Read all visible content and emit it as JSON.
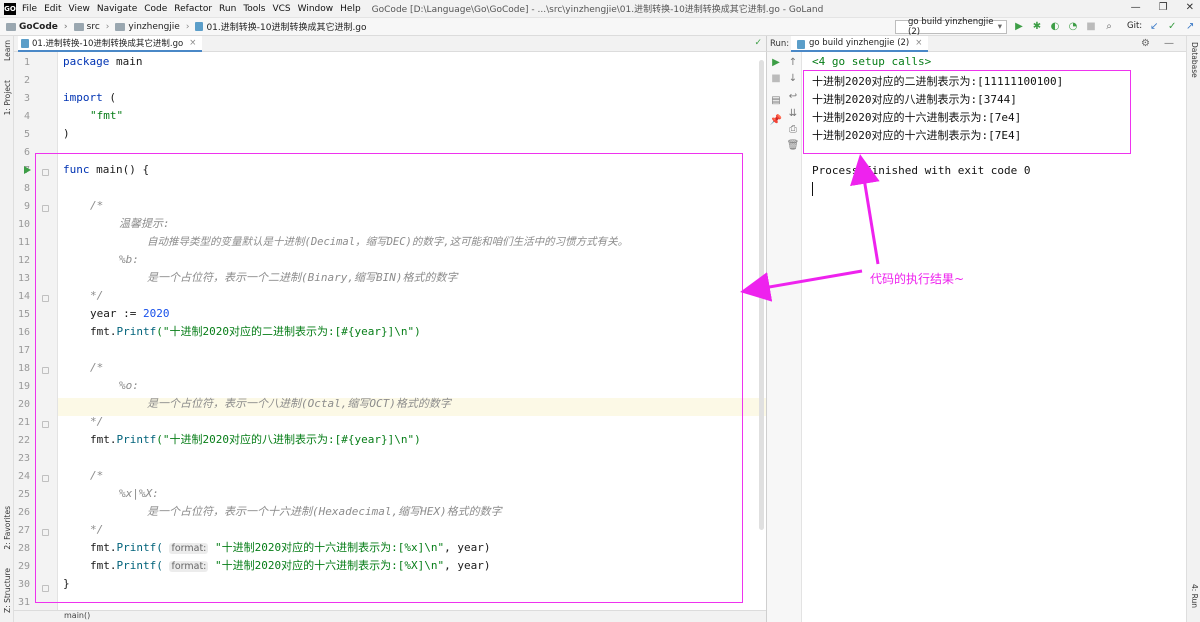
{
  "window": {
    "app_icon": "GO",
    "menu": [
      "File",
      "Edit",
      "View",
      "Navigate",
      "Code",
      "Refactor",
      "Run",
      "Tools",
      "VCS",
      "Window",
      "Help"
    ],
    "title": "GoCode [D:\\Language\\Go\\GoCode] - ...\\src\\yinzhengjie\\01.进制转换-10进制转换成其它进制.go - GoLand"
  },
  "navbar": {
    "breadcrumbs": [
      "GoCode",
      "src",
      "yinzhengjie",
      "01.进制转换-10进制转换成其它进制.go"
    ],
    "run_config": "go build yinzhengjie (2)",
    "git_label": "Git:"
  },
  "side_tools": {
    "left": [
      "1: Project",
      "Learn",
      "2: Favorites",
      "Z: Structure"
    ],
    "right": [
      "Database",
      "4: Run"
    ]
  },
  "editor": {
    "tab_label": "01.进制转换-10进制转换成其它进制.go",
    "status_text": "main()",
    "lines": [
      {
        "n": "1"
      },
      {
        "n": "2"
      },
      {
        "n": "3"
      },
      {
        "n": "4"
      },
      {
        "n": "5"
      },
      {
        "n": "6"
      },
      {
        "n": "7"
      },
      {
        "n": "8"
      },
      {
        "n": "9"
      },
      {
        "n": "10"
      },
      {
        "n": "11"
      },
      {
        "n": "12"
      },
      {
        "n": "13"
      },
      {
        "n": "14"
      },
      {
        "n": "15"
      },
      {
        "n": "16"
      },
      {
        "n": "17"
      },
      {
        "n": "18"
      },
      {
        "n": "19"
      },
      {
        "n": "20"
      },
      {
        "n": "21"
      },
      {
        "n": "22"
      },
      {
        "n": "23"
      },
      {
        "n": "24"
      },
      {
        "n": "25"
      },
      {
        "n": "26"
      },
      {
        "n": "27"
      },
      {
        "n": "28"
      },
      {
        "n": "29"
      },
      {
        "n": "30"
      },
      {
        "n": "31"
      }
    ],
    "code": {
      "l1_kw": "package",
      "l1_name": "main",
      "l3_kw": "import",
      "l3_paren": "(",
      "l4_str": "\"fmt\"",
      "l5_paren": ")",
      "l7_kw": "func",
      "l7_sig": "main() {",
      "l9": "/*",
      "l10": "温馨提示:",
      "l11": "自动推导类型的变量默认是十进制(Decimal，缩写DEC)的数字,这可能和咱们生活中的习惯方式有关。",
      "l12": "%b:",
      "l13": "是一个占位符，表示一个二进制(Binary,缩写BIN)格式的数字",
      "l14": "*/",
      "l15_var": "year",
      "l15_op": ":=",
      "l15_num": "2020",
      "l16_pkg": "fmt.",
      "l16_fn": "Printf",
      "l16_str": "(\"十进制2020对应的二进制表示为:[#{year}]\\n\")",
      "l18": "/*",
      "l19": "%o:",
      "l20": "是一个占位符，表示一个八进制(Octal,缩写OCT)格式的数字",
      "l21": "*/",
      "l22_pkg": "fmt.",
      "l22_fn": "Printf",
      "l22_str": "(\"十进制2020对应的八进制表示为:[#{year}]\\n\")",
      "l24": "/*",
      "l25": "%x|%X:",
      "l26": "是一个占位符，表示一个十六进制(Hexadecimal,缩写HEX)格式的数字",
      "l27": "*/",
      "l28_pkg": "fmt.",
      "l28_fn": "Printf(",
      "hint": "format:",
      "l28_str": "\"十进制2020对应的十六进制表示为:[%x]\\n\"",
      "l28_tail": ", year)",
      "l29_pkg": "fmt.",
      "l29_fn": "Printf(",
      "l29_str": "\"十进制2020对应的十六进制表示为:[%X]\\n\"",
      "l29_tail": ", year)",
      "l30": "}"
    }
  },
  "run_panel": {
    "label": "Run:",
    "tab_label": "go build yinzhengjie (2)",
    "console": {
      "setup": "<4 go setup calls>",
      "out1": "十进制2020对应的二进制表示为:[11111100100]",
      "out2": "十进制2020对应的八进制表示为:[3744]",
      "out3": "十进制2020对应的十六进制表示为:[7e4]",
      "out4": "十进制2020对应的十六进制表示为:[7E4]",
      "finished": "Process finished with exit code 0"
    }
  },
  "annotation": {
    "text": "代码的执行结果~",
    "color": "#ee22ee"
  },
  "colors": {
    "keyword": "#0033b3",
    "string": "#067d17",
    "comment": "#8c8c8c",
    "number": "#1750eb",
    "highlight_line": "#fcf9e6"
  }
}
